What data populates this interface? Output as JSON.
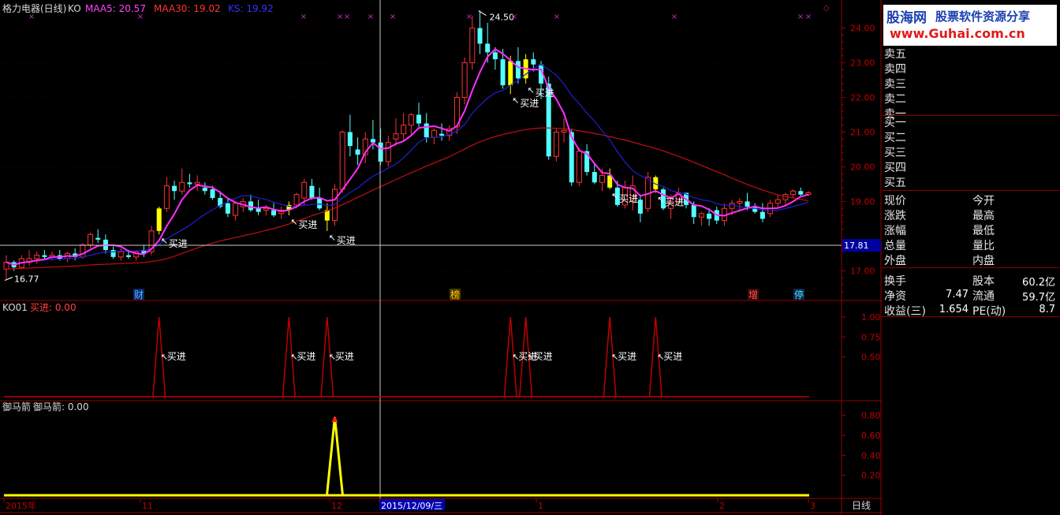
{
  "stock_title": "格力电器(日线)",
  "indicator_name": "KO",
  "ma_labels": [
    {
      "text": "MAA5: 20.57",
      "color": "#ff44ff"
    },
    {
      "text": "MAA30: 19.02",
      "color": "#ff3333"
    },
    {
      "text": "KS: 19.92",
      "color": "#3333ff"
    }
  ],
  "y_ticks": [
    "24.00",
    "23.00",
    "22.00",
    "21.00",
    "20.00",
    "19.00",
    "17.00"
  ],
  "crosshair_price": "17.81",
  "max_label": "24.50",
  "min_label": "16.77",
  "buy_label": "买进",
  "event_markers": [
    {
      "label": "财",
      "color": "#5ab0ff",
      "bg": "#0a2a6a"
    },
    {
      "label": "榜",
      "color": "#ffcc00",
      "bg": "#4a3a00"
    },
    {
      "label": "增",
      "color": "#ff5555",
      "bg": "#3a0a0a"
    },
    {
      "label": "停",
      "color": "#55ddff",
      "bg": "#0a2a4a"
    }
  ],
  "panel2": {
    "title": "KO01",
    "sub": "买进: 0.00",
    "ticks": [
      "1.00",
      "0.75",
      "0.50"
    ]
  },
  "panel3": {
    "title": "御马箭",
    "sub": "御马箭: 0.00",
    "ticks": [
      "0.80",
      "0.60",
      "0.40",
      "0.20"
    ]
  },
  "xaxis": {
    "labels": [
      "2015年",
      "11",
      "12",
      "2015/12/09/三",
      "1",
      "2",
      "3"
    ],
    "period": "日线"
  },
  "logo": {
    "l1": "股海网",
    "l2": "股票软件资源分享",
    "l3": "www.Guhai.com.cn"
  },
  "orderbook": {
    "sell": [
      "卖五",
      "卖四",
      "卖三",
      "卖二",
      "卖一"
    ],
    "buy": [
      "买一",
      "买二",
      "买三",
      "买四",
      "买五"
    ]
  },
  "quote_rows": [
    {
      "k1": "现价",
      "v1": "",
      "k2": "今开",
      "v2": ""
    },
    {
      "k1": "涨跌",
      "v1": "",
      "k2": "最高",
      "v2": ""
    },
    {
      "k1": "涨幅",
      "v1": "",
      "k2": "最低",
      "v2": ""
    },
    {
      "k1": "总量",
      "v1": "",
      "k2": "量比",
      "v2": ""
    },
    {
      "k1": "外盘",
      "v1": "",
      "k2": "内盘",
      "v2": ""
    },
    {
      "k1": "换手",
      "v1": "",
      "k2": "股本",
      "v2": "60.2亿"
    },
    {
      "k1": "净资",
      "v1": "7.47",
      "k2": "流通",
      "v2": "59.7亿"
    },
    {
      "k1": "收益(三)",
      "v1": "1.654",
      "k2": "PE(动)",
      "v2": "8.7"
    }
  ],
  "chart_data": {
    "type": "candlestick",
    "title": "格力电器(日线)",
    "ylim": [
      16.6,
      24.4
    ],
    "series": [
      {
        "name": "MAA5",
        "role": "ma5"
      },
      {
        "name": "MAA30",
        "role": "ma30"
      },
      {
        "name": "KS",
        "role": "ks"
      }
    ],
    "candles": [
      [
        17.05,
        17.45,
        16.77,
        17.25
      ],
      [
        17.25,
        17.3,
        17.0,
        17.1
      ],
      [
        17.1,
        17.45,
        17.05,
        17.35
      ],
      [
        17.25,
        17.6,
        17.15,
        17.35
      ],
      [
        17.35,
        17.55,
        17.2,
        17.45
      ],
      [
        17.45,
        17.6,
        17.3,
        17.4
      ],
      [
        17.4,
        17.55,
        17.3,
        17.45
      ],
      [
        17.45,
        17.6,
        17.3,
        17.35
      ],
      [
        17.35,
        17.55,
        17.25,
        17.5
      ],
      [
        17.5,
        17.65,
        17.3,
        17.4
      ],
      [
        17.4,
        17.8,
        17.35,
        17.75
      ],
      [
        17.75,
        18.1,
        17.65,
        18.05
      ],
      [
        17.95,
        18.2,
        17.8,
        17.9
      ],
      [
        17.9,
        18.05,
        17.5,
        17.6
      ],
      [
        17.6,
        17.7,
        17.35,
        17.4
      ],
      [
        17.4,
        17.65,
        17.3,
        17.55
      ],
      [
        17.45,
        17.6,
        17.35,
        17.4
      ],
      [
        17.4,
        17.6,
        17.3,
        17.55
      ],
      [
        17.6,
        17.75,
        17.4,
        17.5
      ],
      [
        17.55,
        18.3,
        17.45,
        18.15
      ],
      [
        18.15,
        18.85,
        18.05,
        18.8
      ],
      [
        18.8,
        19.7,
        18.7,
        19.45
      ],
      [
        19.45,
        19.6,
        19.05,
        19.3
      ],
      [
        19.3,
        19.95,
        19.2,
        19.55
      ],
      [
        19.55,
        19.8,
        19.4,
        19.5
      ],
      [
        19.5,
        19.75,
        19.3,
        19.55
      ],
      [
        19.4,
        19.55,
        19.2,
        19.3
      ],
      [
        19.35,
        19.45,
        19.05,
        19.1
      ],
      [
        19.1,
        19.3,
        18.8,
        18.85
      ],
      [
        18.95,
        19.1,
        18.55,
        18.65
      ],
      [
        18.6,
        18.95,
        18.45,
        18.95
      ],
      [
        18.85,
        19.1,
        18.7,
        19.0
      ],
      [
        19.0,
        19.2,
        18.7,
        18.75
      ],
      [
        18.8,
        19.05,
        18.6,
        18.7
      ],
      [
        18.75,
        18.9,
        18.6,
        18.8
      ],
      [
        18.75,
        18.95,
        18.55,
        18.6
      ],
      [
        18.65,
        18.85,
        18.5,
        18.75
      ],
      [
        18.75,
        19.0,
        18.6,
        18.9
      ],
      [
        18.9,
        19.25,
        18.8,
        19.2
      ],
      [
        19.1,
        19.65,
        18.9,
        19.55
      ],
      [
        19.45,
        19.65,
        19.05,
        19.1
      ],
      [
        19.1,
        19.4,
        18.75,
        18.8
      ],
      [
        18.75,
        18.95,
        18.15,
        18.45
      ],
      [
        18.45,
        19.5,
        18.3,
        19.35
      ],
      [
        19.35,
        21.05,
        19.25,
        21.0
      ],
      [
        21.0,
        21.5,
        20.3,
        20.6
      ],
      [
        20.5,
        20.85,
        20.05,
        20.35
      ],
      [
        20.35,
        21.0,
        20.1,
        20.8
      ],
      [
        20.8,
        21.35,
        20.5,
        20.7
      ],
      [
        20.7,
        21.1,
        20.05,
        20.15
      ],
      [
        20.15,
        20.9,
        20.0,
        20.7
      ],
      [
        20.8,
        21.4,
        20.6,
        20.95
      ],
      [
        20.95,
        21.55,
        20.75,
        21.2
      ],
      [
        21.2,
        21.55,
        20.9,
        21.5
      ],
      [
        21.5,
        21.85,
        21.15,
        21.25
      ],
      [
        21.25,
        21.55,
        20.7,
        20.85
      ],
      [
        20.85,
        21.1,
        20.65,
        21.05
      ],
      [
        20.95,
        21.25,
        20.75,
        20.9
      ],
      [
        20.9,
        21.2,
        20.75,
        21.1
      ],
      [
        21.15,
        22.15,
        20.95,
        22.0
      ],
      [
        22.0,
        23.15,
        21.8,
        23.0
      ],
      [
        23.0,
        24.35,
        22.8,
        24.0
      ],
      [
        24.0,
        24.5,
        23.25,
        23.55
      ],
      [
        23.55,
        24.15,
        23.0,
        23.3
      ],
      [
        23.3,
        23.45,
        22.8,
        23.1
      ],
      [
        23.1,
        23.4,
        22.25,
        22.35
      ],
      [
        22.35,
        23.2,
        22.1,
        23.05
      ],
      [
        23.05,
        23.45,
        22.4,
        22.55
      ],
      [
        22.55,
        23.25,
        22.4,
        23.1
      ],
      [
        23.1,
        23.3,
        22.75,
        22.95
      ],
      [
        22.95,
        23.05,
        21.95,
        22.4
      ],
      [
        22.4,
        22.6,
        20.2,
        20.3
      ],
      [
        20.3,
        21.1,
        20.15,
        21.0
      ],
      [
        21.0,
        21.4,
        20.7,
        21.05
      ],
      [
        21.0,
        21.1,
        19.45,
        19.55
      ],
      [
        19.55,
        20.55,
        19.45,
        20.45
      ],
      [
        20.45,
        20.65,
        19.75,
        19.85
      ],
      [
        19.85,
        20.1,
        19.5,
        19.55
      ],
      [
        19.55,
        19.95,
        19.3,
        19.75
      ],
      [
        19.75,
        19.95,
        19.35,
        19.4
      ],
      [
        19.4,
        19.6,
        18.85,
        18.9
      ],
      [
        18.9,
        19.6,
        18.8,
        19.4
      ],
      [
        19.0,
        19.75,
        18.75,
        19.45
      ],
      [
        19.05,
        19.2,
        18.4,
        18.65
      ],
      [
        18.8,
        19.85,
        18.7,
        19.7
      ],
      [
        19.7,
        19.75,
        19.25,
        19.35
      ],
      [
        19.35,
        19.4,
        18.75,
        18.8
      ],
      [
        18.8,
        19.2,
        18.5,
        19.0
      ],
      [
        19.0,
        19.4,
        18.9,
        19.25
      ],
      [
        19.25,
        19.25,
        18.8,
        18.9
      ],
      [
        18.9,
        19.0,
        18.35,
        18.55
      ],
      [
        18.55,
        18.7,
        18.3,
        18.65
      ],
      [
        18.65,
        18.8,
        18.3,
        18.5
      ],
      [
        18.75,
        18.85,
        18.35,
        18.45
      ],
      [
        18.45,
        18.95,
        18.3,
        18.8
      ],
      [
        18.8,
        19.05,
        18.6,
        18.95
      ],
      [
        18.95,
        19.1,
        18.7,
        19.0
      ],
      [
        19.0,
        19.25,
        18.75,
        18.85
      ],
      [
        18.85,
        18.95,
        18.65,
        18.7
      ],
      [
        18.7,
        18.95,
        18.4,
        18.5
      ],
      [
        18.65,
        19.05,
        18.55,
        18.95
      ],
      [
        18.95,
        19.2,
        18.8,
        19.05
      ],
      [
        19.05,
        19.25,
        18.9,
        19.2
      ],
      [
        19.2,
        19.35,
        19.1,
        19.3
      ],
      [
        19.3,
        19.4,
        19.15,
        19.2
      ],
      [
        19.2,
        19.3,
        19.15,
        19.25
      ]
    ],
    "ma30": [
      17.05,
      17.06,
      17.07,
      17.08,
      17.09,
      17.1,
      17.11,
      17.12,
      17.13,
      17.14,
      17.15,
      17.17,
      17.18,
      17.19,
      17.2,
      17.21,
      17.22,
      17.23,
      17.24,
      17.27,
      17.3,
      17.35,
      17.42,
      17.5,
      17.58,
      17.66,
      17.73,
      17.8,
      17.86,
      17.91,
      17.96,
      18.01,
      18.06,
      18.11,
      18.17,
      18.22,
      18.28,
      18.35,
      18.43,
      18.51,
      18.59,
      18.66,
      18.73,
      18.81,
      18.91,
      19.01,
      19.12,
      19.22,
      19.33,
      19.43,
      19.53,
      19.63,
      19.73,
      19.83,
      19.92,
      20.02,
      20.11,
      20.2,
      20.29,
      20.4,
      20.51,
      20.62,
      20.72,
      20.8,
      20.87,
      20.93,
      20.98,
      21.03,
      21.07,
      21.1,
      21.12,
      21.12,
      21.11,
      21.1,
      21.07,
      21.04,
      21.0,
      20.96,
      20.92,
      20.87,
      20.82,
      20.77,
      20.71,
      20.65,
      20.59,
      20.53,
      20.46,
      20.38,
      20.3,
      20.22,
      20.13,
      20.04,
      19.95,
      19.86,
      19.77,
      19.67,
      19.58,
      19.49,
      19.41,
      19.33,
      19.26,
      19.19,
      19.14,
      19.1,
      19.06,
      19.02
    ],
    "ks_offset": "ma30 smoothed (10-period)",
    "signals_buy_idx": [
      20,
      37,
      42,
      66,
      68,
      79,
      85
    ],
    "ko01_peaks_idx": [
      20,
      37,
      42,
      66,
      68,
      79,
      85
    ],
    "yumajian_peak_idx": 43,
    "yumajian_peak_value": 0.78
  }
}
